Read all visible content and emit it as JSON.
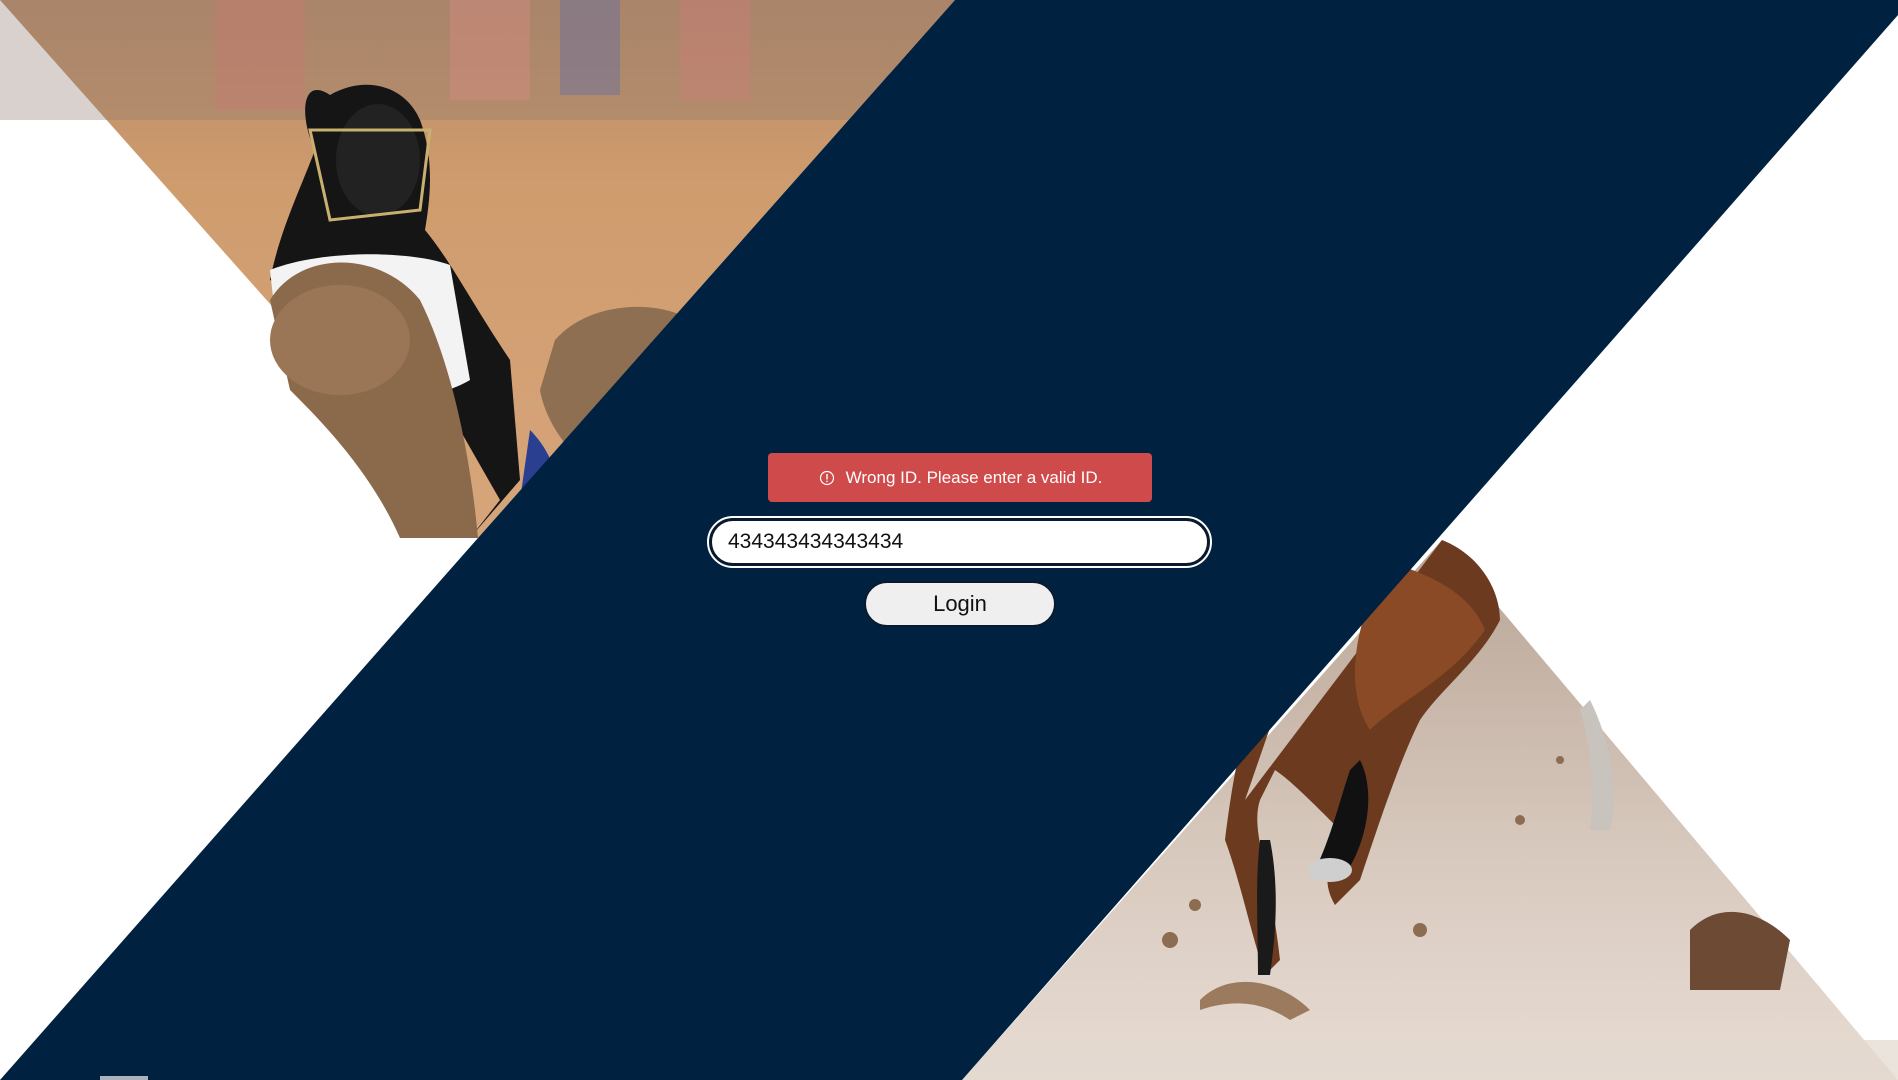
{
  "colors": {
    "navy": "#002240",
    "error_bg": "#cf4a4a",
    "input_bg": "#ffffff",
    "button_bg": "#efefef"
  },
  "images": {
    "top_left": "greyhound-racing-photo",
    "bottom_right": "horse-racing-photo"
  },
  "login": {
    "error_icon": "info-circle-icon",
    "error_message": "Wrong ID. Please enter a valid ID.",
    "id_value": "434343434343434",
    "button_label": "Login"
  }
}
